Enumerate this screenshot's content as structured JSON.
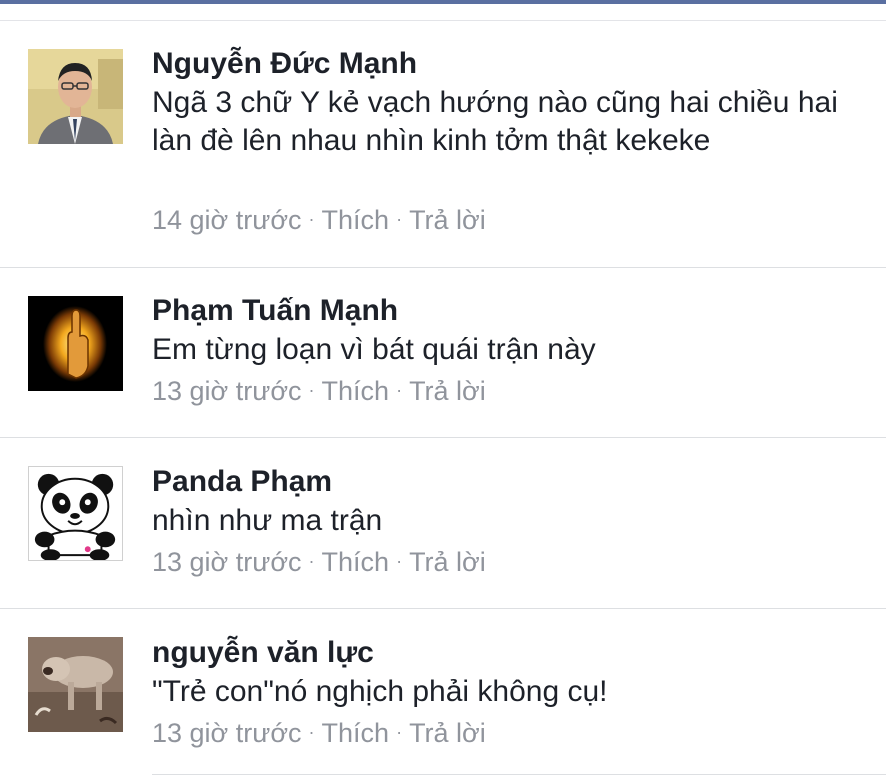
{
  "comments": [
    {
      "author": "Nguyễn Đức Mạnh",
      "text": "Ngã 3 chữ Y kẻ vạch hướng nào cũng hai chiều hai làn đè lên nhau nhìn kinh tởm thật kekeke",
      "time": "14 giờ trước",
      "like": "Thích",
      "reply": "Trả lời",
      "avatar": "man-in-suit-photo"
    },
    {
      "author": "Phạm Tuấn Mạnh",
      "text": "Em từng loạn vì bát quái trận này",
      "time": "13 giờ trước",
      "like": "Thích",
      "reply": "Trả lời",
      "avatar": "flaming-hand-image"
    },
    {
      "author": "Panda Phạm",
      "text": "nhìn như ma trận",
      "time": "13 giờ trước",
      "like": "Thích",
      "reply": "Trả lời",
      "avatar": "panda-cartoon"
    },
    {
      "author": "nguyễn văn lực",
      "text": "\"Trẻ con\"nó nghịch phải không cụ!",
      "time": "13 giờ trước",
      "like": "Thích",
      "reply": "Trả lời",
      "avatar": "dog-photo"
    }
  ],
  "separator": "·",
  "colors": {
    "name": "#1d2129",
    "meta": "#90949c",
    "topbar": "#5a6fa1",
    "divider": "#dddfe2"
  }
}
